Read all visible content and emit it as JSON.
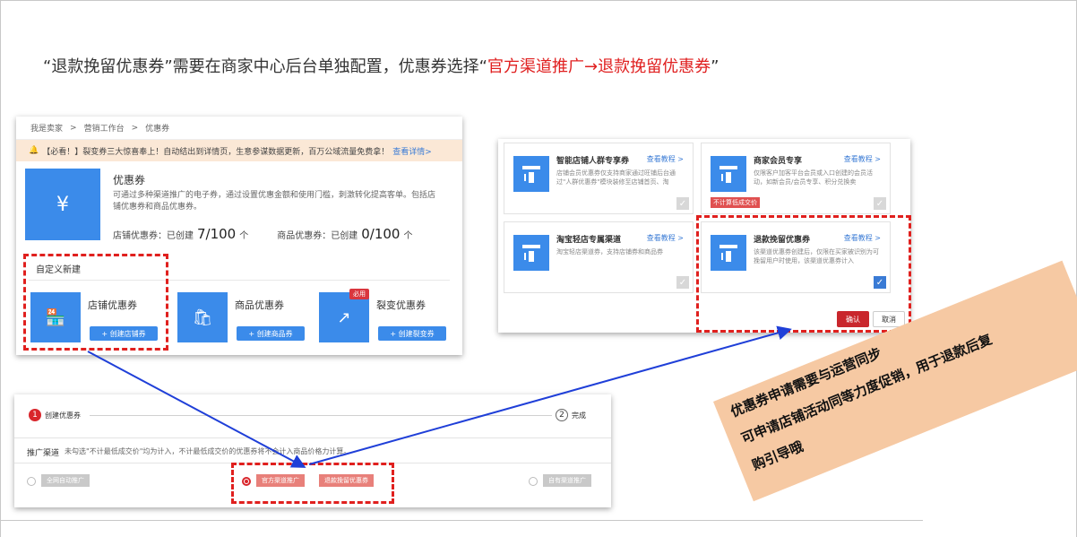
{
  "headline": {
    "part1": "“退款挽留优惠券”需要在商家中心后台单独配置，优惠券选择“",
    "highlight": "官方渠道推广→退款挽留优惠券",
    "part2": "”"
  },
  "panel1": {
    "breadcrumb": [
      "我是卖家",
      ">",
      "营销工作台",
      ">",
      "优惠券"
    ],
    "notice_text": "【必看！】裂变券三大惊喜奉上！自动结出到详情页，生意参谋数据更新，百万公域流量免费拿！",
    "notice_link": "查看详情>",
    "hero_title": "优惠券",
    "hero_desc": "可通过多种渠道推广的电子券，通过设置优惠金额和使用门槛，刺激转化提高客单。包括店铺优惠券和商品优惠券。",
    "stat1_label": "店铺优惠券：已创建",
    "stat1_value": "7/100",
    "stat1_unit": "个",
    "stat2_label": "商品优惠券：已创建",
    "stat2_value": "0/100",
    "stat2_unit": "个",
    "section_title": "自定义新建",
    "cards": [
      {
        "name": "店铺优惠券",
        "button": "+ 创建店铺券",
        "tag": ""
      },
      {
        "name": "商品优惠券",
        "button": "+ 创建商品券",
        "tag": ""
      },
      {
        "name": "裂变优惠券",
        "button": "+ 创建裂变券",
        "tag": "必用"
      }
    ]
  },
  "panel2": {
    "options": [
      {
        "title": "智能店铺人群专享券",
        "tutorial": "查看教程 >",
        "desc": "店铺会员优惠券仅支持商家通过旺铺后台通过\"人群优惠券\"模块装修至店铺首页、淘",
        "tag": "",
        "checked": false
      },
      {
        "title": "商家会员专享",
        "tutorial": "查看教程 >",
        "desc": "仅限客户加客平台会员或入口创建的会员活动，如新会员/会员专享、积分兑换卖",
        "tag": "不计算低成交价",
        "checked": false
      },
      {
        "title": "淘宝轻店专属渠道",
        "tutorial": "查看教程 >",
        "desc": "淘宝轻店渠道券，支持店铺券和商品券",
        "tag": "",
        "checked": false
      },
      {
        "title": "退款挽留优惠券",
        "tutorial": "查看教程 >",
        "desc": "该渠道优惠券创建后，仅限在买家被识别为可挽留用户时使用，该渠道优惠券计入",
        "tag": "",
        "checked": true
      }
    ],
    "confirm": "确认",
    "cancel": "取消"
  },
  "panel3": {
    "step1": "创建优惠券",
    "step1_num": "1",
    "step2": "完成",
    "step2_num": "2",
    "channel_label": "推广渠道",
    "channel_note": "未勾选\"不计最低成交价\"均为计入，不计最低成交价的优惠券将不会计入商品价格力计算。",
    "options": [
      "全网自动推广",
      "官方渠道推广",
      "退款挽留优惠券",
      "自有渠道推广"
    ]
  },
  "banner": {
    "line1": "优惠券申请需要与运营同步",
    "line2": "可申请店铺活动同等力度促销，用于退款后复",
    "line3": "购引导哦"
  },
  "colors": {
    "accent_blue": "#3b8bea",
    "highlight_red": "#e02020",
    "banner_bg": "#f6c9a3"
  }
}
